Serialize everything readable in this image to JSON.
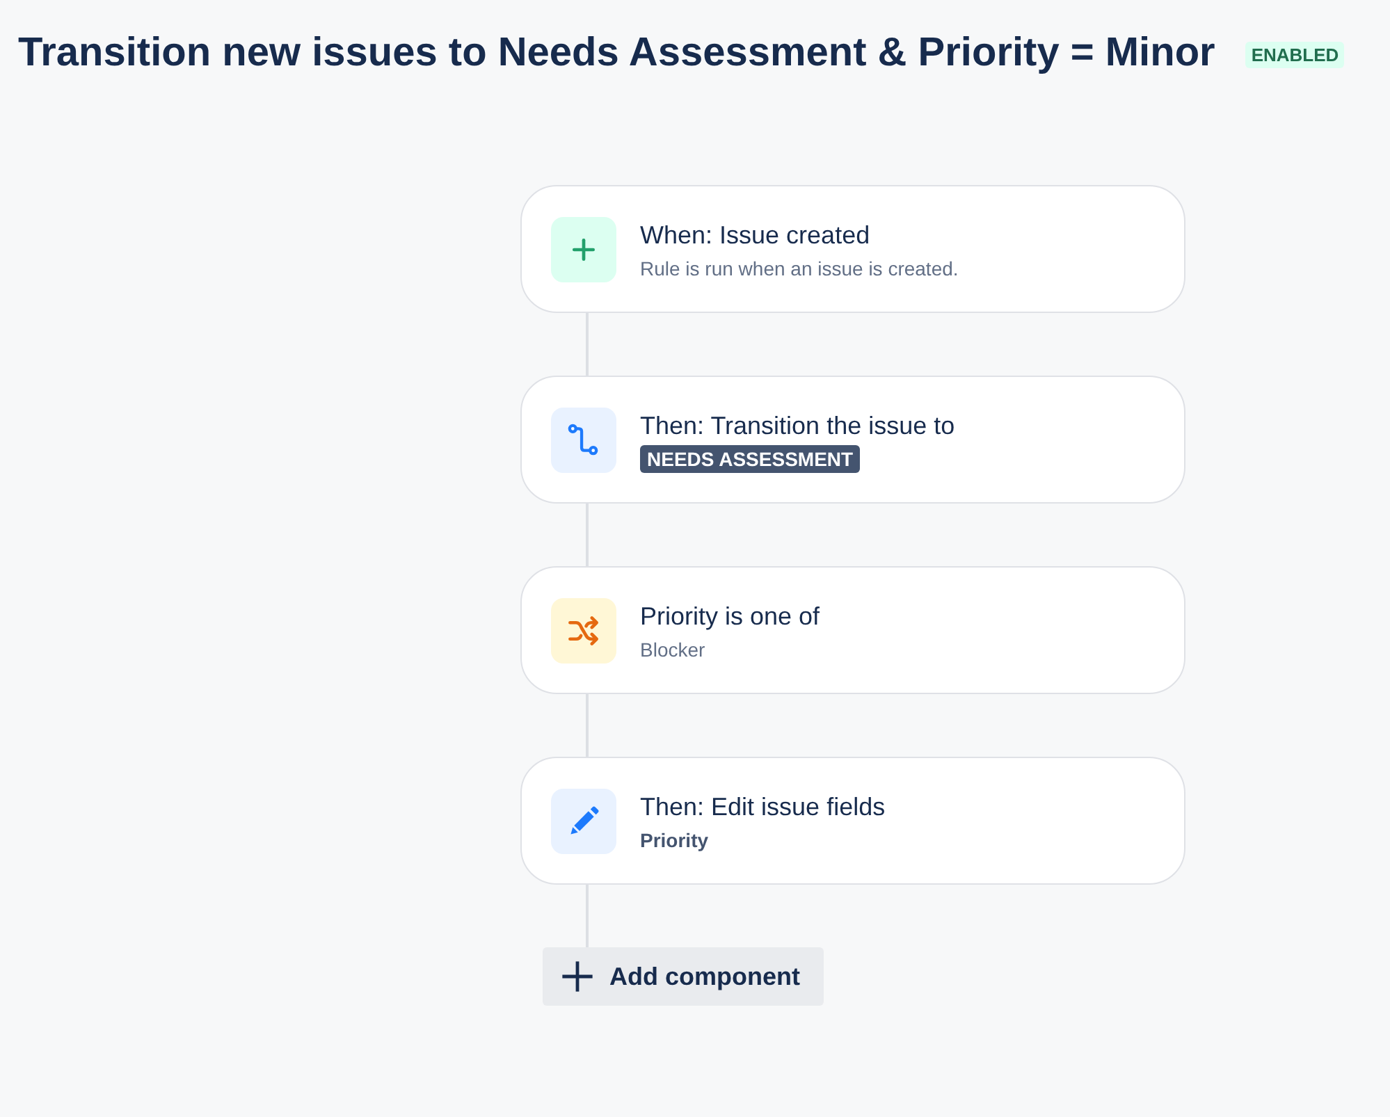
{
  "rule": {
    "title": "Transition new issues to Needs Assessment & Priority = Minor",
    "status": "ENABLED"
  },
  "steps": [
    {
      "kind": "trigger",
      "title": "When: Issue created",
      "detail": {
        "kind": "text",
        "text": "Rule is run when an issue is created."
      }
    },
    {
      "kind": "action",
      "title": "Then: Transition the issue to",
      "detail": {
        "kind": "lozenge",
        "text": "NEEDS ASSESSMENT"
      }
    },
    {
      "kind": "condition",
      "title": "Priority is one of",
      "detail": {
        "kind": "text",
        "text": "Blocker"
      }
    },
    {
      "kind": "edit",
      "title": "Then: Edit issue fields",
      "detail": {
        "kind": "bold",
        "text": "Priority"
      }
    }
  ],
  "add_button": {
    "label": "Add component"
  }
}
